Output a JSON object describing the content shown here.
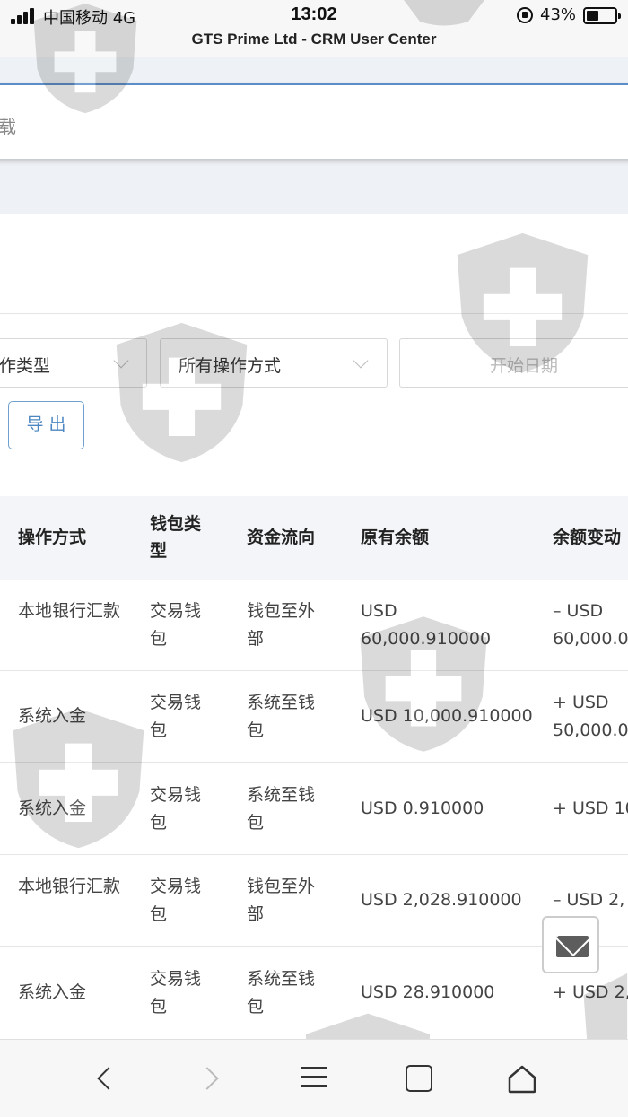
{
  "status_bar": {
    "carrier": "中国移动  4G",
    "time": "13:02",
    "battery_pct": "43%",
    "battery_level": 0.43
  },
  "browser": {
    "page_title": "GTS Prime Ltd - CRM User Center"
  },
  "download_bar": {
    "label": "下载"
  },
  "filters": {
    "type_select": "作类型",
    "method_select": "所有操作方式",
    "start_date_placeholder": "开始日期"
  },
  "export_button": "导出",
  "table": {
    "headers": [
      "操作方式",
      "钱包类型",
      "资金流向",
      "原有余额",
      "余额变动"
    ],
    "rows": [
      [
        "本地银行汇款",
        "交易钱包",
        "钱包至外部",
        "USD 60,000.910000",
        "– USD 60,000.0"
      ],
      [
        "系统入金",
        "交易钱包",
        "系统至钱包",
        "USD 10,000.910000",
        "+ USD 50,000.0"
      ],
      [
        "系统入金",
        "交易钱包",
        "系统至钱包",
        "USD 0.910000",
        "+ USD 10"
      ],
      [
        "本地银行汇款",
        "交易钱包",
        "钱包至外部",
        "USD 2,028.910000",
        "– USD 2,"
      ],
      [
        "系统入金",
        "交易钱包",
        "系统至钱包",
        "USD 28.910000",
        "+ USD 2,"
      ]
    ]
  },
  "icons": {
    "mail": "mail-icon",
    "back": "back-icon",
    "forward": "forward-icon",
    "menu": "menu-icon",
    "tabs": "tabs-icon",
    "home": "home-icon",
    "watermark": "shield-cross-watermark"
  },
  "colors": {
    "accent": "#4d87c2",
    "header_bg": "#f3f5f8",
    "band_bg": "#eef1f5"
  }
}
